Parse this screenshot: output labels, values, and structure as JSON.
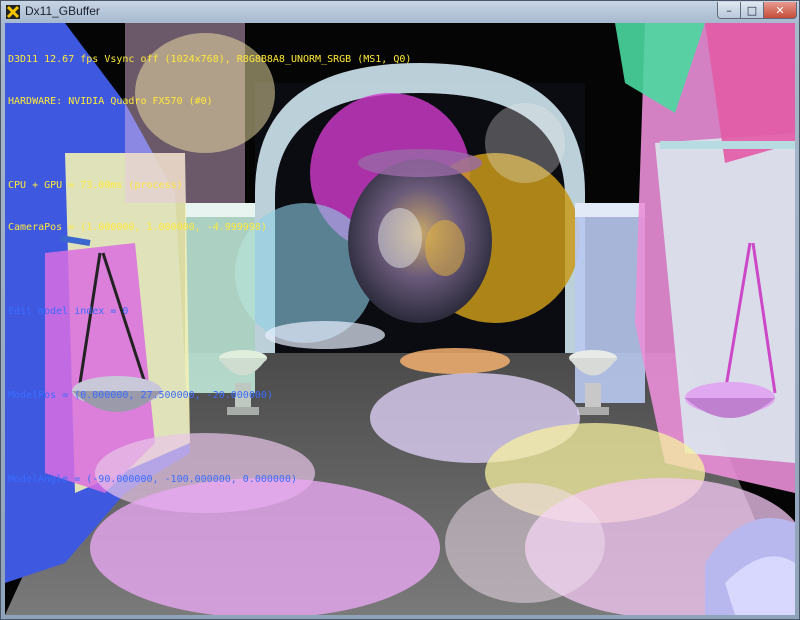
{
  "window": {
    "title": "Dx11_GBuffer",
    "minimize_glyph": "–",
    "maximize_glyph": "□",
    "close_glyph": "✕"
  },
  "hud": {
    "line1": "D3D11 12.67 fps Vsync off (1024x768), R8G8B8A8_UNORM_SRGB (MS1, Q0)",
    "line2": "HARDWARE: NVIDIA Quadro FX570 (#0)",
    "line3": "CPU + GPU = 73.00ms (process)",
    "line4": "CameraPos = (1.000000, 1.000000, -4.999998)",
    "line5": "Edit model index = 0",
    "line6": "ModelPos = (0.000000, 27.500000, -20.000000)",
    "line7": "ModelAngle = (-90.000000, -100.000000, 0.000000)"
  },
  "colors": {
    "hud_yellow": "#ffe93a",
    "hud_blue": "#3b6cff",
    "close_red": "#c54d3a"
  }
}
